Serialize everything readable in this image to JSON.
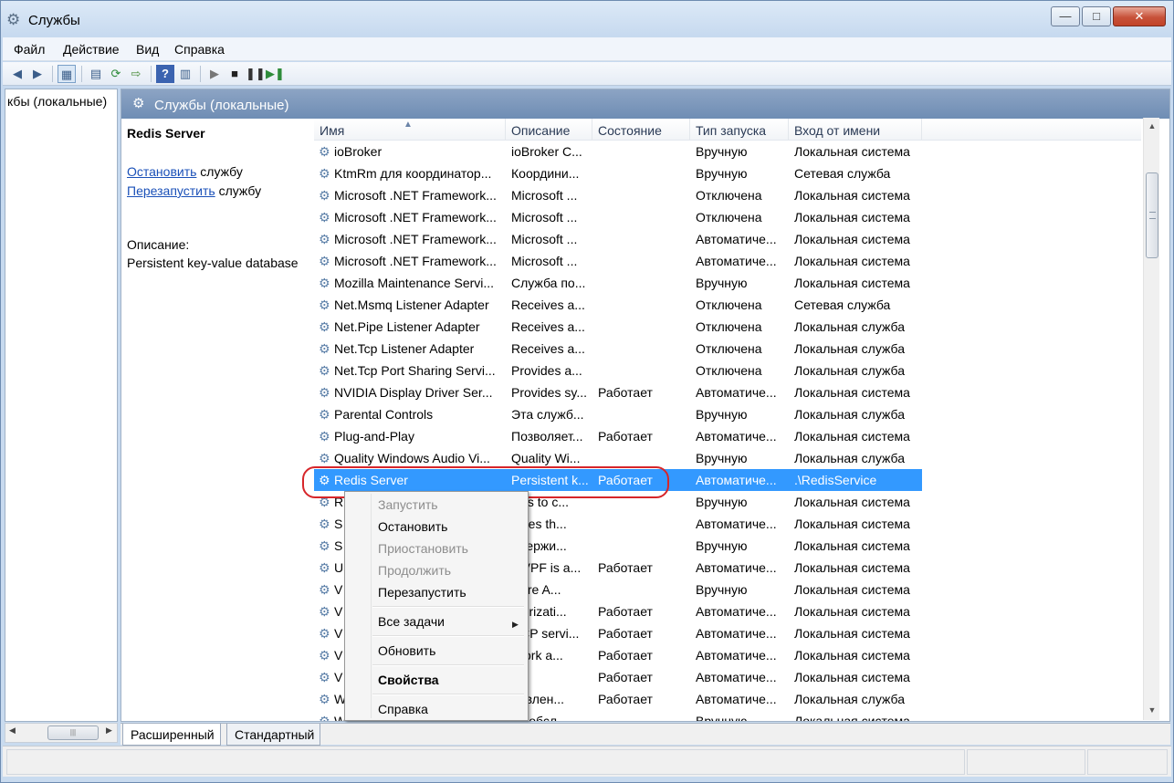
{
  "window": {
    "title": "Службы",
    "minimize_glyph": "—",
    "maximize_glyph": "□",
    "close_glyph": "✕"
  },
  "menubar": [
    "Файл",
    "Действие",
    "Вид",
    "Справка"
  ],
  "toolbar": {
    "icons": [
      "back-icon",
      "forward-icon",
      "console-tree-icon",
      "properties-icon",
      "refresh-icon",
      "export-list-icon",
      "help-icon",
      "show-hide-action-pane-icon",
      "start-service-icon",
      "stop-service-icon",
      "pause-service-icon",
      "restart-service-icon"
    ]
  },
  "left_pane": {
    "node_label": "кбы (локальные)"
  },
  "header": {
    "title": "Службы (локальные)"
  },
  "detail": {
    "service_name": "Redis Server",
    "stop_link": "Остановить",
    "stop_suffix": " службу",
    "restart_link": "Перезапустить",
    "restart_suffix": " службу",
    "description_label": "Описание:",
    "description": "Persistent key-value database"
  },
  "columns": [
    "Имя",
    "Описание",
    "Состояние",
    "Тип запуска",
    "Вход от имени"
  ],
  "rows": [
    {
      "name": "ioBroker",
      "desc": "ioBroker C...",
      "status": "",
      "startup": "Вручную",
      "logon": "Локальная система"
    },
    {
      "name": "KtmRm для координатор...",
      "desc": "Координи...",
      "status": "",
      "startup": "Вручную",
      "logon": "Сетевая служба"
    },
    {
      "name": "Microsoft .NET Framework...",
      "desc": "Microsoft ...",
      "status": "",
      "startup": "Отключена",
      "logon": "Локальная система"
    },
    {
      "name": "Microsoft .NET Framework...",
      "desc": "Microsoft ...",
      "status": "",
      "startup": "Отключена",
      "logon": "Локальная система"
    },
    {
      "name": "Microsoft .NET Framework...",
      "desc": "Microsoft ...",
      "status": "",
      "startup": "Автоматиче...",
      "logon": "Локальная система"
    },
    {
      "name": "Microsoft .NET Framework...",
      "desc": "Microsoft ...",
      "status": "",
      "startup": "Автоматиче...",
      "logon": "Локальная система"
    },
    {
      "name": "Mozilla Maintenance Servi...",
      "desc": "Служба по...",
      "status": "",
      "startup": "Вручную",
      "logon": "Локальная система"
    },
    {
      "name": "Net.Msmq Listener Adapter",
      "desc": "Receives a...",
      "status": "",
      "startup": "Отключена",
      "logon": "Сетевая служба"
    },
    {
      "name": "Net.Pipe Listener Adapter",
      "desc": "Receives a...",
      "status": "",
      "startup": "Отключена",
      "logon": "Локальная служба"
    },
    {
      "name": "Net.Tcp Listener Adapter",
      "desc": "Receives a...",
      "status": "",
      "startup": "Отключена",
      "logon": "Локальная служба"
    },
    {
      "name": "Net.Tcp Port Sharing Servi...",
      "desc": "Provides a...",
      "status": "",
      "startup": "Отключена",
      "logon": "Локальная служба"
    },
    {
      "name": "NVIDIA Display Driver Ser...",
      "desc": "Provides sy...",
      "status": "Работает",
      "startup": "Автоматиче...",
      "logon": "Локальная система"
    },
    {
      "name": "Parental Controls",
      "desc": "Эта служб...",
      "status": "",
      "startup": "Вручную",
      "logon": "Локальная служба"
    },
    {
      "name": "Plug-and-Play",
      "desc": "Позволяет...",
      "status": "Работает",
      "startup": "Автоматиче...",
      "logon": "Локальная система"
    },
    {
      "name": "Quality Windows Audio Vi...",
      "desc": "Quality Wi...",
      "status": "",
      "startup": "Вручную",
      "logon": "Локальная служба"
    },
    {
      "name": "Redis Server",
      "desc": "Persistent k...",
      "status": "Работает",
      "startup": "Автоматиче...",
      "logon": ".\\RedisService",
      "selected": true
    },
    {
      "name": "R",
      "desc": "ows to c...",
      "status": "",
      "startup": "Вручную",
      "logon": "Локальная система"
    },
    {
      "name": "S",
      "desc": "ables th...",
      "status": "",
      "startup": "Автоматиче...",
      "logon": "Локальная система"
    },
    {
      "name": "S",
      "desc": "ддержи...",
      "status": "",
      "startup": "Вручную",
      "logon": "Локальная система"
    },
    {
      "name": "U",
      "desc": "MVPF is a...",
      "status": "Работает",
      "startup": "Автоматиче...",
      "logon": "Локальная система"
    },
    {
      "name": "V",
      "desc": "ware A...",
      "status": "",
      "startup": "Вручную",
      "logon": "Локальная система"
    },
    {
      "name": "V",
      "desc": "thorizati...",
      "status": "Работает",
      "startup": "Автоматиче...",
      "logon": "Локальная система"
    },
    {
      "name": "V",
      "desc": "HCP servi...",
      "status": "Работает",
      "startup": "Автоматиче...",
      "logon": "Локальная система"
    },
    {
      "name": "V",
      "desc": "twork a...",
      "status": "Работает",
      "startup": "Автоматиче...",
      "logon": "Локальная система"
    },
    {
      "name": "V",
      "desc": "",
      "status": "Работает",
      "startup": "Автоматиче...",
      "logon": "Локальная система"
    },
    {
      "name": "W",
      "desc": "равлен...",
      "status": "Работает",
      "startup": "Автоматиче...",
      "logon": "Локальная служба"
    },
    {
      "name": "W",
      "desc": "ая обсл...",
      "status": "",
      "startup": "Вручную",
      "logon": "Локальная система"
    }
  ],
  "context_menu": [
    {
      "label": "Запустить",
      "state": "disabled"
    },
    {
      "label": "Остановить",
      "state": "enabled"
    },
    {
      "label": "Приостановить",
      "state": "disabled"
    },
    {
      "label": "Продолжить",
      "state": "disabled"
    },
    {
      "label": "Перезапустить",
      "state": "enabled"
    },
    {
      "label": "Все задачи",
      "state": "enabled",
      "submenu": true
    },
    {
      "label": "Обновить",
      "state": "enabled"
    },
    {
      "label": "Свойства",
      "state": "default"
    },
    {
      "label": "Справка",
      "state": "enabled"
    }
  ],
  "tabs": [
    "Расширенный",
    "Стандартный"
  ]
}
